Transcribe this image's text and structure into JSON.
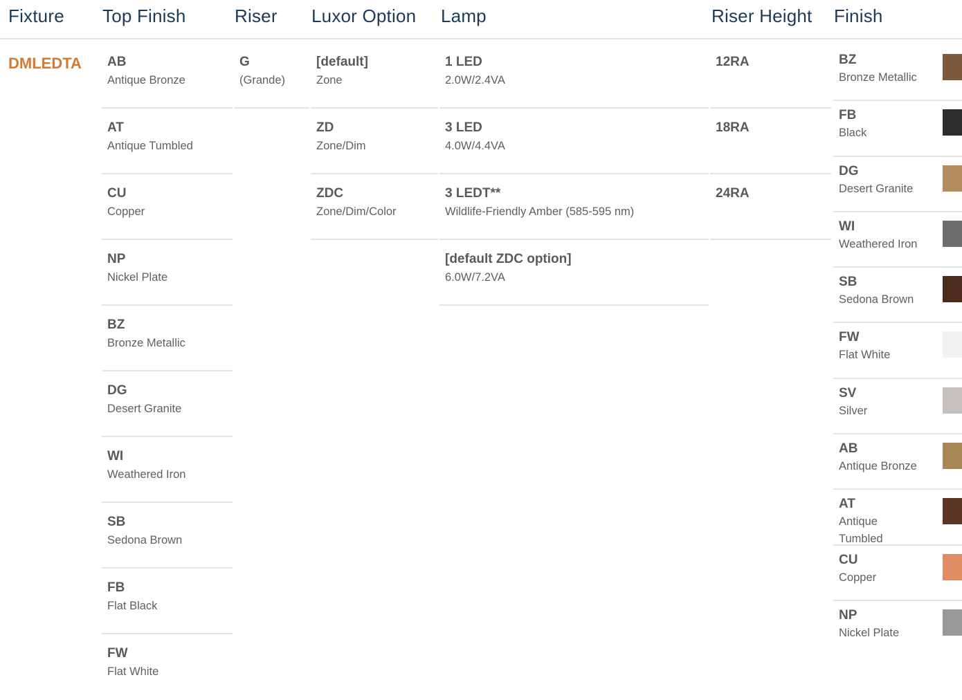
{
  "headers": {
    "fixture": "Fixture",
    "top_finish": "Top Finish",
    "riser": "Riser",
    "luxor_option": "Luxor Option",
    "lamp": "Lamp",
    "riser_height": "Riser Height",
    "finish": "Finish"
  },
  "fixture": {
    "code": "DMLEDTA"
  },
  "top_finish": [
    {
      "code": "AB",
      "desc": "Antique Bronze"
    },
    {
      "code": "AT",
      "desc": "Antique Tumbled"
    },
    {
      "code": "CU",
      "desc": "Copper"
    },
    {
      "code": "NP",
      "desc": "Nickel Plate"
    },
    {
      "code": "BZ",
      "desc": "Bronze Metallic"
    },
    {
      "code": "DG",
      "desc": "Desert Granite"
    },
    {
      "code": "WI",
      "desc": "Weathered Iron"
    },
    {
      "code": "SB",
      "desc": "Sedona Brown"
    },
    {
      "code": "FB",
      "desc": "Flat Black"
    },
    {
      "code": "FW",
      "desc": "Flat White"
    }
  ],
  "riser": [
    {
      "code": "G",
      "desc": "(Grande)"
    }
  ],
  "luxor_option": [
    {
      "code": "[default]",
      "desc": "Zone"
    },
    {
      "code": "ZD",
      "desc": "Zone/Dim"
    },
    {
      "code": "ZDC",
      "desc": "Zone/Dim/Color"
    }
  ],
  "lamp": [
    {
      "code": "1 LED",
      "desc": "2.0W/2.4VA"
    },
    {
      "code": "3 LED",
      "desc": "4.0W/4.4VA"
    },
    {
      "code": "3 LEDT**",
      "desc": "Wildlife-Friendly Amber (585-595 nm)"
    },
    {
      "code": "[default ZDC option]",
      "desc": "6.0W/7.2VA"
    }
  ],
  "riser_height": [
    {
      "code": "12RA"
    },
    {
      "code": "18RA"
    },
    {
      "code": "24RA"
    }
  ],
  "finish": [
    {
      "code": "BZ",
      "desc": "Bronze Metallic",
      "swatch": "#7a5a3a"
    },
    {
      "code": "FB",
      "desc": "Black",
      "swatch": "#2e2d2e"
    },
    {
      "code": "DG",
      "desc": "Desert Granite",
      "swatch": "#b48a5f"
    },
    {
      "code": "WI",
      "desc": "Weathered Iron",
      "swatch": "#6e6d6d"
    },
    {
      "code": "SB",
      "desc": "Sedona Brown",
      "swatch": "#4d2b1c"
    },
    {
      "code": "FW",
      "desc": "Flat White",
      "swatch": "#f3f2f0"
    },
    {
      "code": "SV",
      "desc": "Silver",
      "swatch": "#c4c1be"
    },
    {
      "code": "AB",
      "desc": "Antique Bronze",
      "swatch": "#a98757"
    },
    {
      "code": "AT",
      "desc": "Antique Tumbled",
      "swatch": "#5a3424"
    },
    {
      "code": "CU",
      "desc": "Copper",
      "swatch": "#df8b63"
    },
    {
      "code": "NP",
      "desc": "Nickel Plate",
      "swatch": "#9a9898"
    }
  ]
}
